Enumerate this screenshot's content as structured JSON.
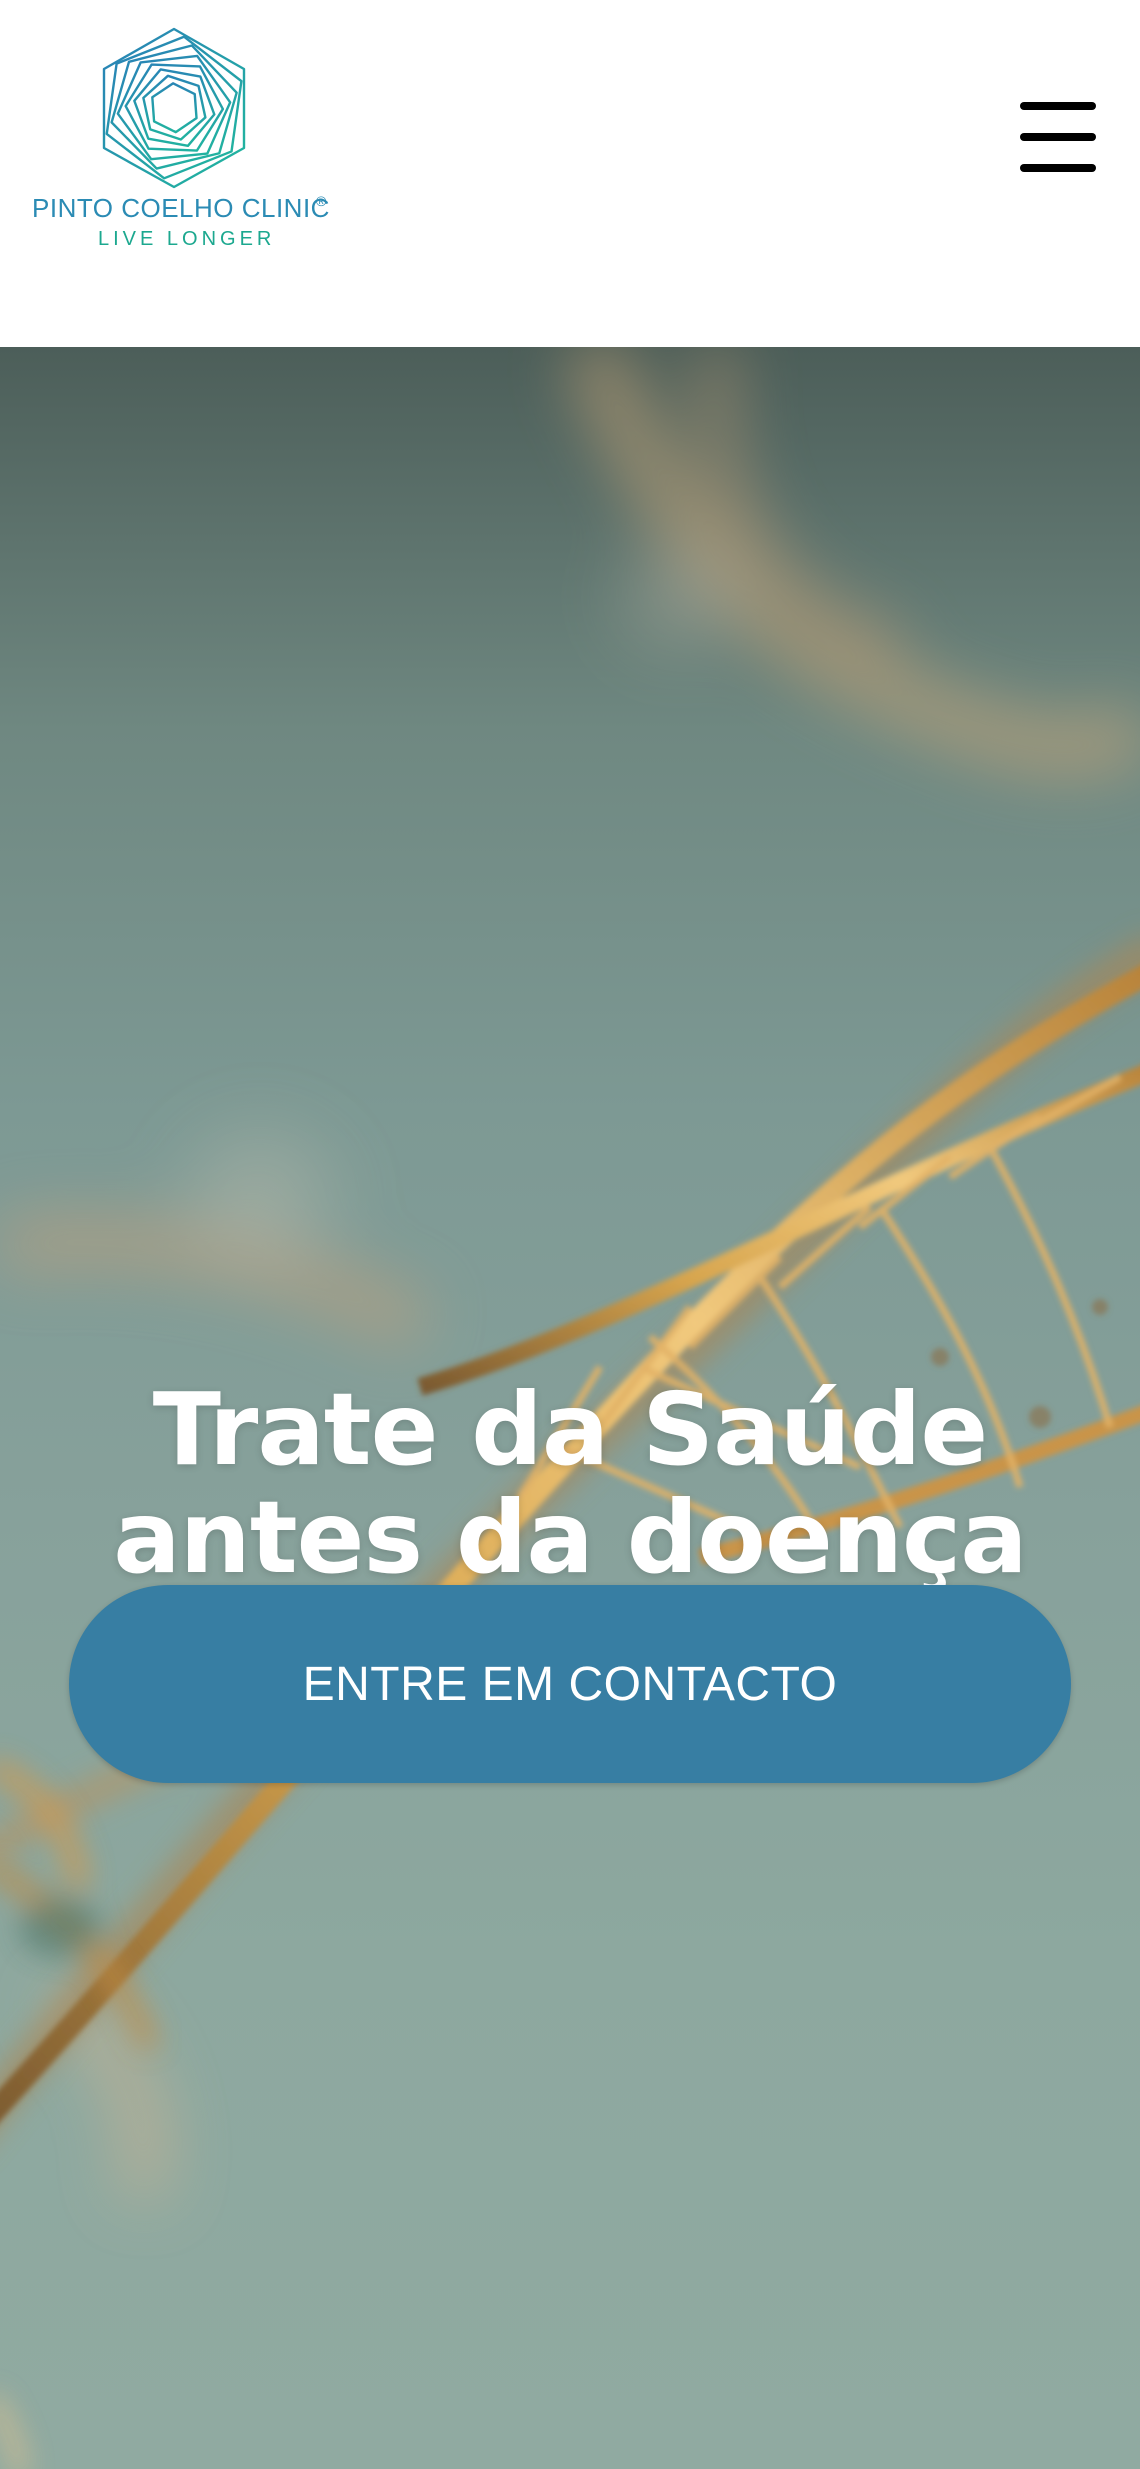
{
  "header": {
    "brand_name": "PINTO COELHO CLINIC",
    "brand_mark": "®",
    "tagline": "LIVE LONGER",
    "logo_icon": "hexagon-spiral-logo-icon",
    "menu_icon": "hamburger-menu-icon"
  },
  "hero": {
    "title_line1": "Trate da Saúde",
    "title_line2": "antes da doença",
    "cta_label": "ENTRE EM CONTACTO",
    "background": "dna-helix-background-image"
  },
  "colors": {
    "brand_blue": "#2b8bb4",
    "brand_green": "#1ca88f",
    "cta_blue": "#377ea3",
    "hero_teal": "#8da89f",
    "helix_gold": "#d8a24a"
  }
}
